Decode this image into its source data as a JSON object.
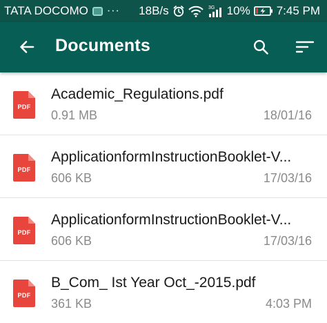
{
  "status_bar": {
    "carrier": "TATA DOCOMO",
    "more": "···",
    "speed": "18B/s",
    "network": "3G",
    "battery": "10%",
    "time": "7:45 PM"
  },
  "app_bar": {
    "title": "Documents",
    "icons": {
      "back": "arrow-back-icon",
      "search": "search-icon",
      "sort": "sort-icon"
    }
  },
  "file_icon_label": "PDF",
  "colors": {
    "status_bar": "#0e544b",
    "app_bar": "#075e54",
    "pdf_icon": "#e8453c"
  },
  "files": [
    {
      "name": "Academic_Regulations.pdf",
      "size": "0.91 MB",
      "date": "18/01/16"
    },
    {
      "name": "ApplicationformInstructionBooklet-V...",
      "size": "606 KB",
      "date": "17/03/16"
    },
    {
      "name": "ApplicationformInstructionBooklet-V...",
      "size": "606 KB",
      "date": "17/03/16"
    },
    {
      "name": "B_Com_ Ist Year Oct_-2015.pdf",
      "size": "361 KB",
      "date": "4:03 PM"
    }
  ]
}
